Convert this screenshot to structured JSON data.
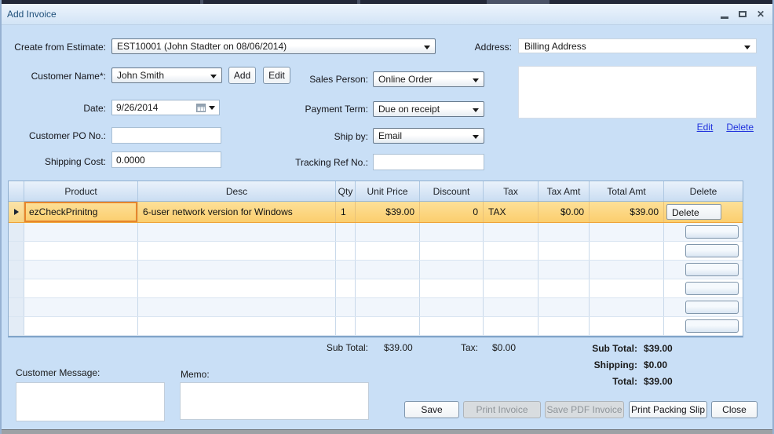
{
  "window": {
    "title": "Add Invoice"
  },
  "form": {
    "create_from_estimate": {
      "label": "Create from Estimate:",
      "value": "EST10001 (John Stadter on 08/06/2014)"
    },
    "address": {
      "label": "Address:",
      "value": "Billing Address",
      "edit_link": "Edit",
      "delete_link": "Delete",
      "address_text": ""
    },
    "customer_name": {
      "label": "Customer Name*:",
      "value": "John Smith",
      "add_button": "Add",
      "edit_button": "Edit"
    },
    "sales_person": {
      "label": "Sales Person:",
      "value": "Online Order"
    },
    "date": {
      "label": "Date:",
      "value": "9/26/2014"
    },
    "payment_term": {
      "label": "Payment Term:",
      "value": "Due on receipt"
    },
    "customer_po": {
      "label": "Customer PO No.:",
      "value": ""
    },
    "ship_by": {
      "label": "Ship by:",
      "value": "Email"
    },
    "shipping_cost": {
      "label": "Shipping Cost:",
      "value": "0.0000"
    },
    "tracking_ref": {
      "label": "Tracking Ref No.:",
      "value": ""
    }
  },
  "table": {
    "headers": [
      "Product",
      "Desc",
      "Qty",
      "Unit Price",
      "Discount",
      "Tax",
      "Tax Amt",
      "Total Amt",
      "Delete"
    ],
    "rows": [
      {
        "product": "ezCheckPrinitng",
        "desc": "6-user network version for Windows",
        "qty": "1",
        "unit_price": "$39.00",
        "discount": "0",
        "tax": "TAX",
        "tax_amt": "$0.00",
        "total_amt": "$39.00",
        "delete_label": "Delete"
      }
    ],
    "empty_row_count": 6
  },
  "totals": {
    "sub_total_label": "Sub Total:",
    "sub_total_value": "$39.00",
    "tax_label": "Tax:",
    "tax_value": "$0.00",
    "summary": [
      {
        "label": "Sub Total:",
        "value": "$39.00"
      },
      {
        "label": "Shipping:",
        "value": "$0.00"
      },
      {
        "label": "Total:",
        "value": "$39.00"
      }
    ]
  },
  "messages": {
    "customer_message_label": "Customer Message:",
    "customer_message_value": "",
    "memo_label": "Memo:",
    "memo_value": ""
  },
  "footer_buttons": {
    "save": "Save",
    "print_invoice": "Print Invoice",
    "save_pdf": "Save PDF Invoice",
    "print_packing_slip": "Print Packing Slip",
    "close": "Close"
  }
}
